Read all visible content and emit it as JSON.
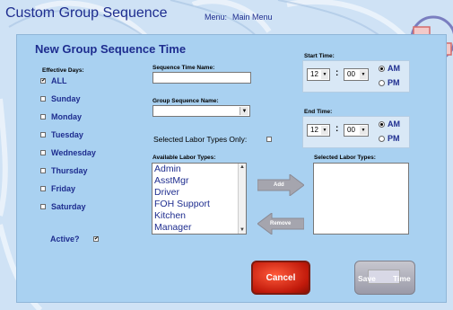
{
  "header": {
    "app_title": "Custom Group Sequence",
    "menu_label": "Menu:",
    "menu_link": "Main Menu"
  },
  "dialog": {
    "title": "New Group Sequence Time",
    "effective_days_label": "Effective Days:",
    "days": [
      {
        "label": "ALL",
        "checked": true
      },
      {
        "label": "Sunday",
        "checked": false
      },
      {
        "label": "Monday",
        "checked": false
      },
      {
        "label": "Tuesday",
        "checked": false
      },
      {
        "label": "Wednesday",
        "checked": false
      },
      {
        "label": "Thursday",
        "checked": false
      },
      {
        "label": "Friday",
        "checked": false
      },
      {
        "label": "Saturday",
        "checked": false
      }
    ],
    "active_label": "Active?",
    "active_checked": true,
    "sequence_time_name_label": "Sequence Time Name:",
    "sequence_time_name_value": "",
    "group_sequence_name_label": "Group Sequence Name:",
    "group_sequence_name_value": "",
    "selected_labor_only_label": "Selected Labor Types Only:",
    "selected_labor_only_checked": false,
    "available_labor_label": "Available Labor Types:",
    "available_labor_types": [
      "Admin",
      "AsstMgr",
      "Driver",
      "FOH Support",
      "Kitchen",
      "Manager"
    ],
    "selected_labor_label": "Selected Labor Types:",
    "selected_labor_types": [],
    "add_label": "Add",
    "remove_label": "Remove",
    "start_time_label": "Start Time:",
    "start_hour": "12",
    "start_minute": "00",
    "end_time_label": "End Time:",
    "end_hour": "12",
    "end_minute": "00",
    "am_label": "AM",
    "pm_label": "PM",
    "colon": ":",
    "cancel_label": "Cancel",
    "save_label_left": "Save",
    "save_label_right": "Time"
  },
  "colors": {
    "background": "#cfe2f5",
    "dialog": "#a9d1f1",
    "text_blue": "#1e2d8f",
    "cancel_red": "#c11a0b"
  }
}
